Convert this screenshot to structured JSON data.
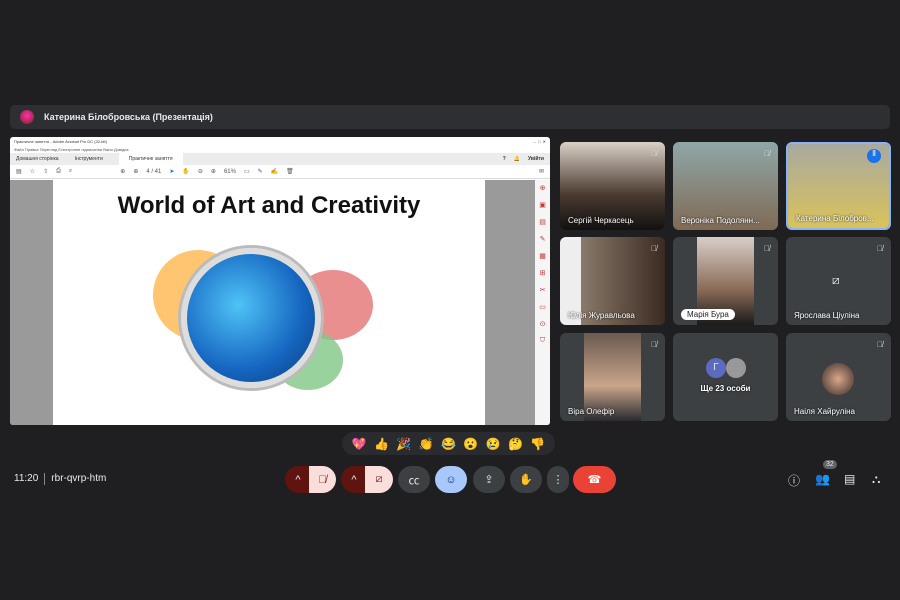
{
  "header": {
    "presenter": "Катерина Білобровська (Презентація)"
  },
  "acrobat": {
    "window_title": "Практичне заняття - Adobe Acrobat Pro DC (32-bit)",
    "menu": "Файл  Правка  Перегляд  Електронне підписання  Вікно  Довідка",
    "tabs": [
      "Домашня сторінка",
      "Інструменти",
      "Практичне заняття"
    ],
    "signin": "Увійти",
    "page": "4 / 41",
    "zoom": "61%",
    "slide_title": "World of Art and Creativity"
  },
  "participants": [
    {
      "name": "Сергій Черкасець",
      "muted": true
    },
    {
      "name": "Вероніка Подолянн...",
      "muted": true
    },
    {
      "name": "Катерина Білобров...",
      "speaking": true
    },
    {
      "name": "Юлія Журавльова",
      "muted": true
    },
    {
      "name": "Марія Бура",
      "muted": true
    },
    {
      "name": "Ярослава Ціуліна",
      "muted": true,
      "camera_off": true
    },
    {
      "name": "Віра Олефір",
      "muted": true
    },
    {
      "name": "Ще 23 особи",
      "initial": "Г"
    },
    {
      "name": "Наіля Хайруліна",
      "muted": true
    }
  ],
  "reactions": [
    "💖",
    "👍",
    "🎉",
    "👏",
    "😂",
    "😮",
    "😢",
    "🤔",
    "👎"
  ],
  "meeting": {
    "time": "11:20",
    "code": "rbr-qvrp-htm",
    "participant_count": "32"
  },
  "colors": {
    "accent": "#8ab4f8",
    "danger": "#ea4335",
    "muted_bg": "#601410"
  }
}
